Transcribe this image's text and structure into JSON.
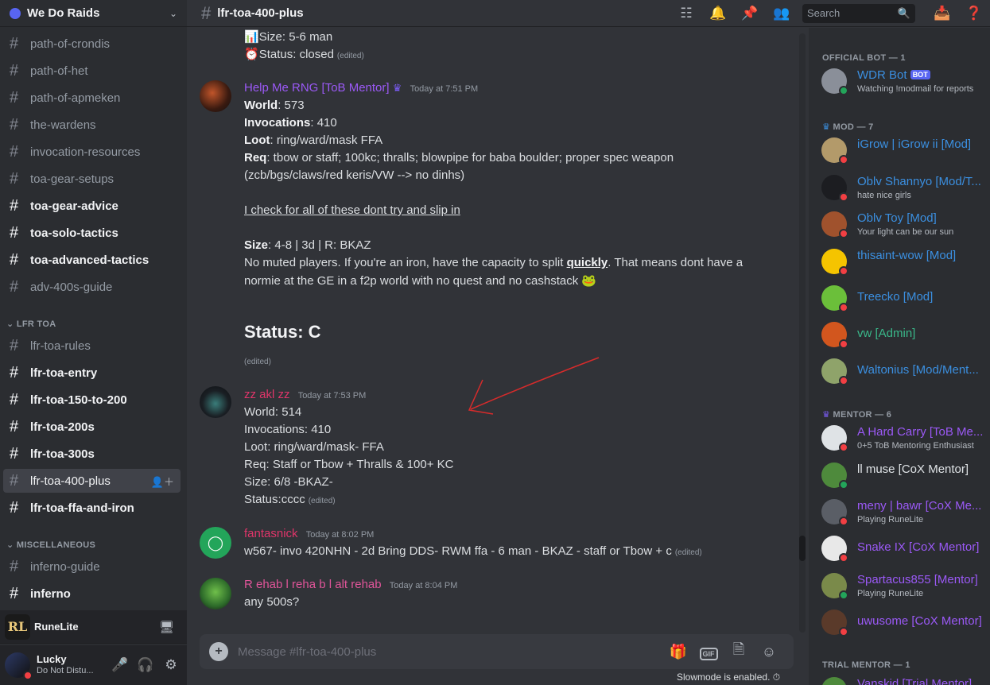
{
  "server": {
    "name": "We Do Raids"
  },
  "sidebar": {
    "channels": [
      {
        "name": "path-of-crondis"
      },
      {
        "name": "path-of-het"
      },
      {
        "name": "path-of-apmeken"
      },
      {
        "name": "the-wardens"
      },
      {
        "name": "invocation-resources"
      },
      {
        "name": "toa-gear-setups"
      },
      {
        "name": "toa-gear-advice"
      },
      {
        "name": "toa-solo-tactics"
      },
      {
        "name": "toa-advanced-tactics"
      },
      {
        "name": "adv-400s-guide"
      }
    ],
    "cat_lfr": "LFR TOA",
    "lfr_channels": [
      {
        "name": "lfr-toa-rules"
      },
      {
        "name": "lfr-toa-entry"
      },
      {
        "name": "lfr-toa-150-to-200"
      },
      {
        "name": "lfr-toa-200s"
      },
      {
        "name": "lfr-toa-300s"
      },
      {
        "name": "lfr-toa-400-plus"
      },
      {
        "name": "lfr-toa-ffa-and-iron"
      }
    ],
    "cat_misc": "MISCELLANEOUS",
    "misc_channels": [
      {
        "name": "inferno-guide"
      },
      {
        "name": "inferno"
      }
    ]
  },
  "voice": {
    "name": "RuneLite",
    "icon_text": "RL"
  },
  "user": {
    "name": "Lucky",
    "status": "Do Not Distu..."
  },
  "topbar": {
    "channel": "lfr-toa-400-plus",
    "search_placeholder": "Search"
  },
  "messages": {
    "prev": {
      "size_label": "Size:",
      "size": "5-6 man",
      "status_label": "Status:",
      "status": "closed",
      "edited": "(edited)"
    },
    "m1": {
      "author": "Help Me RNG [ToB Mentor]",
      "time": "Today at 7:51 PM",
      "world_label": "World",
      "world": ": 573",
      "inv_label": "Invocations",
      "inv": ":  410",
      "loot_label": "Loot",
      "loot": ": ring/ward/mask FFA",
      "req_label": "Req",
      "req": ": tbow or staff; 100kc; thralls; blowpipe for baba boulder; proper spec weapon",
      "req2": "(zcb/bgs/claws/red keris/VW --> no dinhs)",
      "check": "I check for all of these dont try and slip in",
      "size_label": "Size",
      "size": ": 4-8  |  3d  |  R: BKAZ",
      "muted_a": "No muted players. If you're an iron, have the capacity to split ",
      "muted_b": "quickly",
      "muted_c": ". That means dont have a",
      "muted2": "normie at the GE in a f2p world with no quest and no cashstack",
      "status_heading": "Status: C",
      "edited": "(edited)"
    },
    "m2": {
      "author": "zz akl zz",
      "time": "Today at 7:53 PM",
      "lines": [
        "World: 514",
        "Invocations:  410",
        "Loot: ring/ward/mask- FFA",
        "Req: Staff or Tbow + Thralls & 100+ KC",
        "Size: 6/8  -BKAZ-"
      ],
      "status": "Status:cccc",
      "edited": "(edited)"
    },
    "m3": {
      "author": "fantasnick",
      "time": "Today at 8:02 PM",
      "text": "w567- invo 420NHN - 2d Bring DDS- RWM ffa - 6 man - BKAZ - staff or Tbow  + c",
      "edited": "(edited)"
    },
    "m4": {
      "author": "R ehab l reha b l alt rehab",
      "time": "Today at 8:04 PM",
      "text": "any 500s?"
    }
  },
  "composer": {
    "placeholder": "Message #lfr-toa-400-plus",
    "gif": "GIF",
    "slowmode": "Slowmode is enabled."
  },
  "members": {
    "cat_bot": "OFFICIAL BOT — 1",
    "bot": {
      "name": "WDR Bot",
      "tag": "BOT",
      "sub": "Watching !modmail for reports"
    },
    "cat_mod": "MOD — 7",
    "mods": [
      {
        "name": "iGrow | iGrow ii [Mod]",
        "sub": ""
      },
      {
        "name": "Oblv Shannyo [Mod/T...",
        "sub": "hate nice girls"
      },
      {
        "name": "Oblv Toy [Mod]",
        "sub": "Your light can be our sun"
      },
      {
        "name": "thisaint-wow [Mod]",
        "sub": ""
      },
      {
        "name": "Treecko [Mod]",
        "sub": ""
      },
      {
        "name": "vw [Admin]",
        "sub": ""
      },
      {
        "name": "Waltonius [Mod/Ment...",
        "sub": ""
      }
    ],
    "cat_mentor": "MENTOR — 6",
    "mentors": [
      {
        "name": "A Hard Carry [ToB Me...",
        "sub": "0+5 ToB Mentoring Enthusiast"
      },
      {
        "name": "ll muse [CoX Mentor]",
        "sub": ""
      },
      {
        "name": "meny | bawr [CoX Me...",
        "sub": "Playing RuneLite"
      },
      {
        "name": "Snake IX [CoX Mentor]",
        "sub": ""
      },
      {
        "name": "Spartacus855 [Mentor]",
        "sub": "Playing RuneLite"
      },
      {
        "name": "uwusome [CoX Mentor]",
        "sub": ""
      }
    ],
    "cat_trial": "TRIAL MENTOR — 1",
    "trial": {
      "name": "Vanskid [Trial Mentor]"
    }
  }
}
